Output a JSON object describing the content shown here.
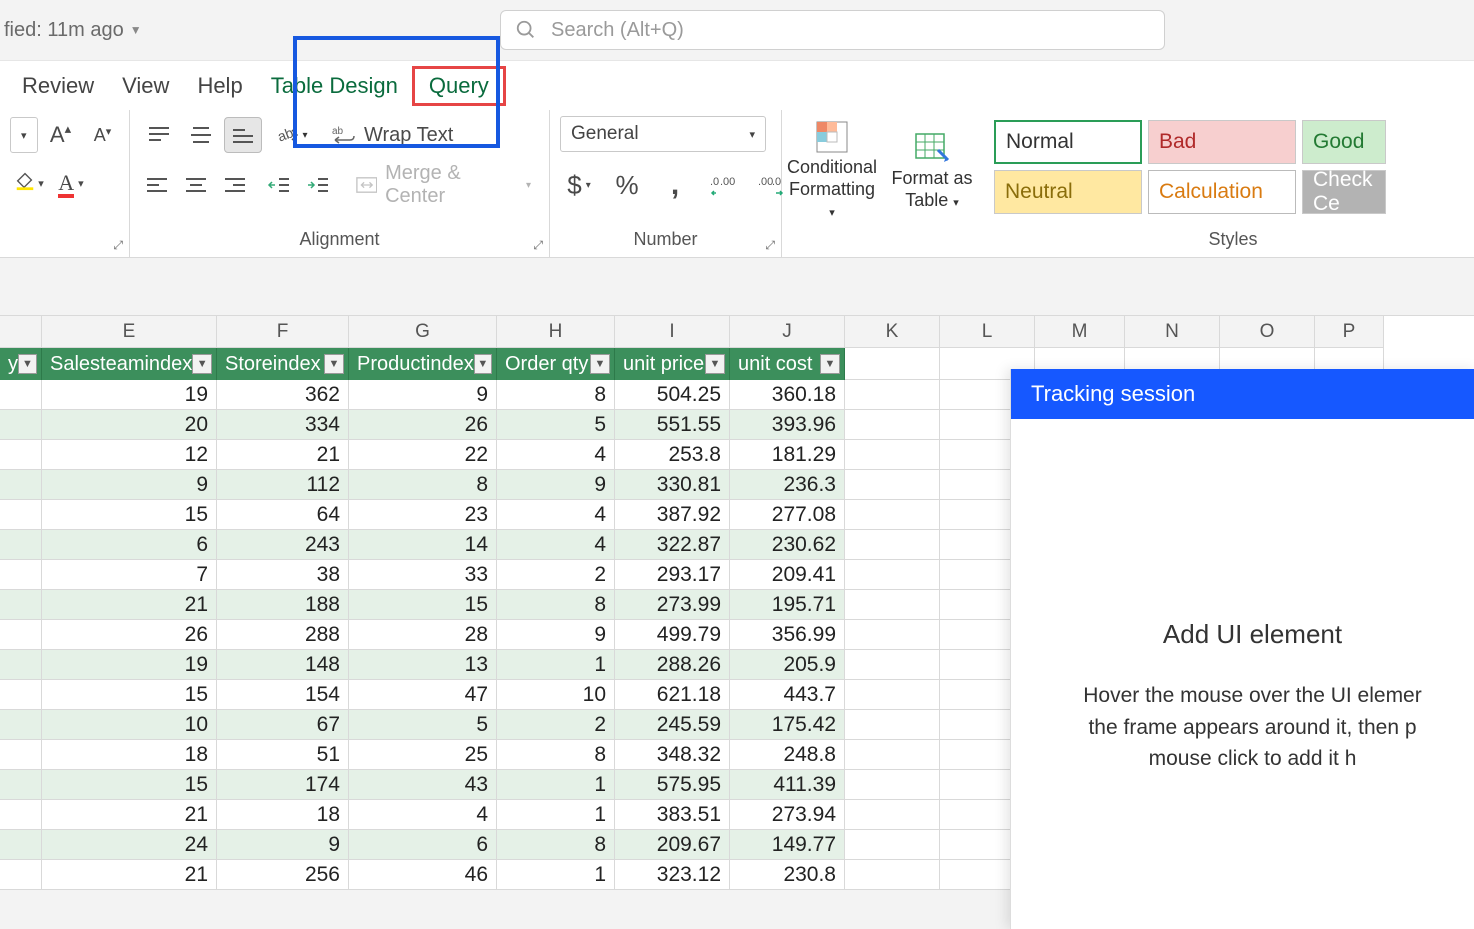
{
  "topbar": {
    "modified": "fied: 11m ago",
    "search_placeholder": "Search (Alt+Q)"
  },
  "tabs": {
    "review": "Review",
    "view": "View",
    "help": "Help",
    "table_design": "Table Design",
    "query": "Query"
  },
  "ribbon": {
    "wrap_text": "Wrap Text",
    "merge_center": "Merge & Center",
    "alignment": "Alignment",
    "number_format": "General",
    "number": "Number",
    "conditional": "Conditional Formatting",
    "format_table": "Format as Table",
    "styles_label": "Styles",
    "styles": {
      "normal": "Normal",
      "bad": "Bad",
      "good": "Good",
      "neutral": "Neutral",
      "calculation": "Calculation",
      "check_cell": "Check Ce"
    }
  },
  "columns": [
    "",
    "E",
    "F",
    "G",
    "H",
    "I",
    "J",
    "K",
    "L",
    "M",
    "N",
    "O",
    "P"
  ],
  "headers": [
    "y",
    "Salesteamindex",
    "Storeindex",
    "Productindex",
    "Order qty",
    "unit price",
    "unit cost"
  ],
  "rows": [
    [
      "19",
      "362",
      "9",
      "8",
      "504.25",
      "360.18"
    ],
    [
      "20",
      "334",
      "26",
      "5",
      "551.55",
      "393.96"
    ],
    [
      "12",
      "21",
      "22",
      "4",
      "253.8",
      "181.29"
    ],
    [
      "9",
      "112",
      "8",
      "9",
      "330.81",
      "236.3"
    ],
    [
      "15",
      "64",
      "23",
      "4",
      "387.92",
      "277.08"
    ],
    [
      "6",
      "243",
      "14",
      "4",
      "322.87",
      "230.62"
    ],
    [
      "7",
      "38",
      "33",
      "2",
      "293.17",
      "209.41"
    ],
    [
      "21",
      "188",
      "15",
      "8",
      "273.99",
      "195.71"
    ],
    [
      "26",
      "288",
      "28",
      "9",
      "499.79",
      "356.99"
    ],
    [
      "19",
      "148",
      "13",
      "1",
      "288.26",
      "205.9"
    ],
    [
      "15",
      "154",
      "47",
      "10",
      "621.18",
      "443.7"
    ],
    [
      "10",
      "67",
      "5",
      "2",
      "245.59",
      "175.42"
    ],
    [
      "18",
      "51",
      "25",
      "8",
      "348.32",
      "248.8"
    ],
    [
      "15",
      "174",
      "43",
      "1",
      "575.95",
      "411.39"
    ],
    [
      "21",
      "18",
      "4",
      "1",
      "383.51",
      "273.94"
    ],
    [
      "24",
      "9",
      "6",
      "8",
      "209.67",
      "149.77"
    ],
    [
      "21",
      "256",
      "46",
      "1",
      "323.12",
      "230.8"
    ]
  ],
  "panel": {
    "title": "Tracking session",
    "heading": "Add UI element",
    "text1": "Hover the mouse over the UI elemer",
    "text2": "the frame appears around it, then p",
    "text3": "mouse click to add it h"
  }
}
